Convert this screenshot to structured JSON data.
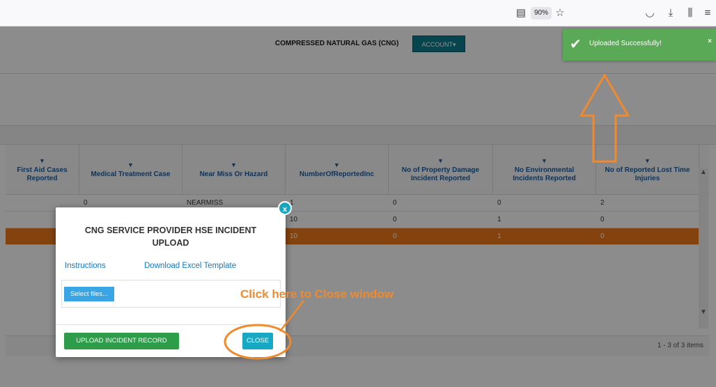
{
  "browser": {
    "zoom": "90%",
    "icons": [
      "reader-view-icon",
      "bookmark-star-icon",
      "pocket-icon",
      "download-icon",
      "library-icon",
      "menu-icon"
    ]
  },
  "header": {
    "title": "COMPRESSED NATURAL GAS (CNG)",
    "account_label": "ACCOUNT"
  },
  "toast": {
    "message": "Uploaded Successfully!",
    "close_label": "×"
  },
  "grid": {
    "columns": [
      "First Aid Cases Reported",
      "Medical Treatment Case",
      "Near Miss Or Hazard",
      "NumberOfReportedInc",
      "No of Property Damage Incident Reported",
      "No Environmental Incidents Reported",
      "No of Reported Lost Time Injuries"
    ],
    "rows": [
      [
        "",
        "0",
        "NEARMISS",
        "1",
        "0",
        "0",
        "2"
      ],
      [
        "",
        "",
        "",
        "10",
        "0",
        "1",
        "0"
      ],
      [
        "",
        "",
        "",
        "10",
        "0",
        "1",
        "0"
      ]
    ],
    "pager": "1 - 3 of 3 items"
  },
  "modal": {
    "title": "CNG SERVICE PROVIDER HSE INCIDENT UPLOAD",
    "instructions_link": "Instructions",
    "template_link": "Download Excel Template",
    "select_files": "Select files...",
    "upload_button": "UPLOAD INCIDENT RECORD",
    "close_button": "CLOSE",
    "close_x": "x"
  },
  "annotation": {
    "text": "Click here to Close window",
    "color": "#f08a2e"
  }
}
